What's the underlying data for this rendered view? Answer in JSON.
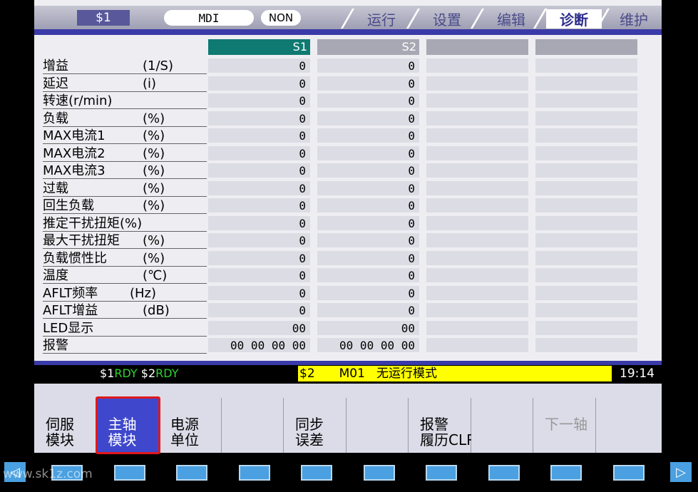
{
  "header": {
    "system": "$1",
    "mode": "MDI",
    "sub_mode": "NON",
    "tabs": [
      "运行",
      "设置",
      "编辑",
      "诊断",
      "维护"
    ],
    "active_tab": "诊断"
  },
  "table": {
    "columns": [
      "S1",
      "S2",
      "",
      ""
    ],
    "rows": [
      {
        "name": "增益",
        "unit": "(1/S)",
        "s1": "0",
        "s2": "0"
      },
      {
        "name": "延迟",
        "unit": "(i)",
        "s1": "0",
        "s2": "0"
      },
      {
        "name": "转速(r/min)",
        "unit": "",
        "s1": "0",
        "s2": "0"
      },
      {
        "name": "负载",
        "unit": "(%)",
        "s1": "0",
        "s2": "0"
      },
      {
        "name": "MAX电流1",
        "unit": "(%)",
        "s1": "0",
        "s2": "0"
      },
      {
        "name": "MAX电流2",
        "unit": "(%)",
        "s1": "0",
        "s2": "0"
      },
      {
        "name": "MAX电流3",
        "unit": "(%)",
        "s1": "0",
        "s2": "0"
      },
      {
        "name": "过载",
        "unit": "(%)",
        "s1": "0",
        "s2": "0"
      },
      {
        "name": "回生负载",
        "unit": "(%)",
        "s1": "0",
        "s2": "0"
      },
      {
        "name": "推定干扰扭矩(%)",
        "unit": "",
        "s1": "0",
        "s2": "0"
      },
      {
        "name": "最大干扰扭矩",
        "unit": "(%)",
        "s1": "0",
        "s2": "0"
      },
      {
        "name": "负载惯性比",
        "unit": "(%)",
        "s1": "0",
        "s2": "0"
      },
      {
        "name": "温度",
        "unit": "(℃)",
        "s1": "0",
        "s2": "0"
      },
      {
        "name": "AFLT频率",
        "unit": "(Hz)",
        "s1": "0",
        "s2": "0"
      },
      {
        "name": "AFLT增益",
        "unit": "(dB)",
        "s1": "0",
        "s2": "0"
      },
      {
        "name": "LED显示",
        "unit": "",
        "s1": "00",
        "s2": "00"
      },
      {
        "name": "报警",
        "unit": "",
        "s1": "00 00 00 00",
        "s2": "00 00 00 00"
      }
    ]
  },
  "status": {
    "sys1": "$1",
    "rdy1": "RDY",
    "sys2": "$2",
    "rdy2": "RDY",
    "message_sys": "$2",
    "message_prog": "M01",
    "message_text": "无运行模式",
    "clock": "19:14"
  },
  "softkeys": [
    {
      "label": "伺服\n模块",
      "active": false,
      "dim": false
    },
    {
      "label": "主轴\n模块",
      "active": true,
      "dim": false
    },
    {
      "label": "电源\n单位",
      "active": false,
      "dim": false
    },
    {
      "label": "",
      "active": false,
      "dim": false
    },
    {
      "label": "同步\n误差",
      "active": false,
      "dim": false
    },
    {
      "label": "",
      "active": false,
      "dim": false
    },
    {
      "label": "报警\n履历CLR",
      "active": false,
      "dim": false
    },
    {
      "label": "",
      "active": false,
      "dim": false
    },
    {
      "label": "下一轴",
      "active": false,
      "dim": true
    }
  ],
  "watermark": "www.sk1z.com",
  "colors": {
    "active_column_header": "#0e7a72",
    "inactive_column_header": "#a8a8b4",
    "status_highlight": "#ffff00",
    "ready_green": "#2fd22f",
    "active_softkey": "#3f48cc",
    "selection_border": "#e0181c"
  }
}
